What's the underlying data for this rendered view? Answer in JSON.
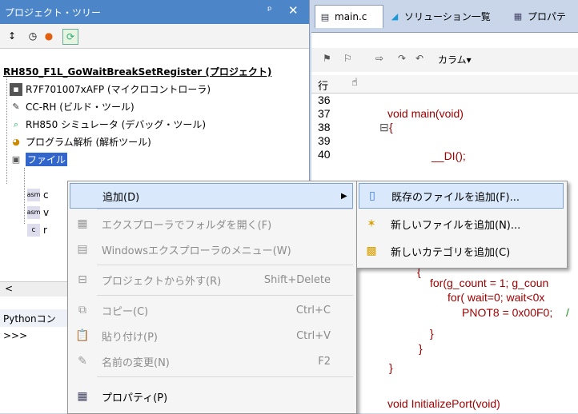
{
  "left_pane": {
    "title": "プロジェクト・ツリー",
    "pin_glyph": "ᵖ",
    "close_glyph": "✕",
    "tree": {
      "project": "RH850_F1L_GoWaitBreakSetRegister (プロジェクト)",
      "items": [
        {
          "label": "R7F701007xAFP (マイクロコントローラ)",
          "icon": "chip-icon"
        },
        {
          "label": "CC-RH (ビルド・ツール)",
          "icon": "build-tool-icon"
        },
        {
          "label": "RH850 シミュレータ (デバッグ・ツール)",
          "icon": "debug-tool-icon"
        },
        {
          "label": "プログラム解析 (解析ツール)",
          "icon": "analysis-icon"
        },
        {
          "label": "ファイル",
          "icon": "folder-icon"
        }
      ],
      "file_children": [
        {
          "label": "c",
          "badge": "asm"
        },
        {
          "label": "v",
          "badge": "asm"
        },
        {
          "label": "r",
          "badge": "c"
        }
      ]
    },
    "scroll_left": "<",
    "python_title": "Pythonコン",
    "python_prompt": ">>>"
  },
  "right_pane": {
    "tabs": [
      {
        "label": "main.c"
      },
      {
        "label": "ソリューション一覧"
      },
      {
        "label": "プロパテ"
      }
    ],
    "toolbar_column_label": "カラム▾",
    "gutter_header": "行",
    "line_numbers": [
      "36",
      "37",
      "38",
      "39",
      "40"
    ],
    "code": {
      "main_sig": "void main(void)",
      "brace_open": "{",
      "di_call": "__DI();",
      "lone_brace": "{",
      "for_line": "for(g_count = 1; g_coun",
      "for_inner": "for( wait=0; wait<0x",
      "pnot": "PNOT8 = 0x00F0;",
      "comment_tail": "/",
      "close1": "}",
      "close2": "}",
      "close3": "}",
      "init_sig": "void InitializePort(void)"
    }
  },
  "context_menu": {
    "items": [
      {
        "label": "追加(D)",
        "shortcut": "",
        "has_submenu": true,
        "enabled": true
      },
      {
        "label": "エクスプローラでフォルダを開く(F)",
        "shortcut": "",
        "enabled": false
      },
      {
        "label": "Windowsエクスプローラのメニュー(W)",
        "shortcut": "",
        "enabled": false
      },
      {
        "label": "プロジェクトから外す(R)",
        "shortcut": "Shift+Delete",
        "enabled": false
      },
      {
        "label": "コピー(C)",
        "shortcut": "Ctrl+C",
        "enabled": false
      },
      {
        "label": "貼り付け(P)",
        "shortcut": "Ctrl+V",
        "enabled": false
      },
      {
        "label": "名前の変更(N)",
        "shortcut": "F2",
        "enabled": false
      },
      {
        "label": "プロパティ(P)",
        "shortcut": "",
        "enabled": true
      }
    ],
    "submenu": [
      {
        "label": "既存のファイルを追加(F)..."
      },
      {
        "label": "新しいファイルを追加(N)..."
      },
      {
        "label": "新しいカテゴリを追加(C)"
      }
    ]
  },
  "colors": {
    "title_bar": "#4c86c8",
    "highlight_bg": "#d9e8fb",
    "keyword": "#a00000"
  }
}
